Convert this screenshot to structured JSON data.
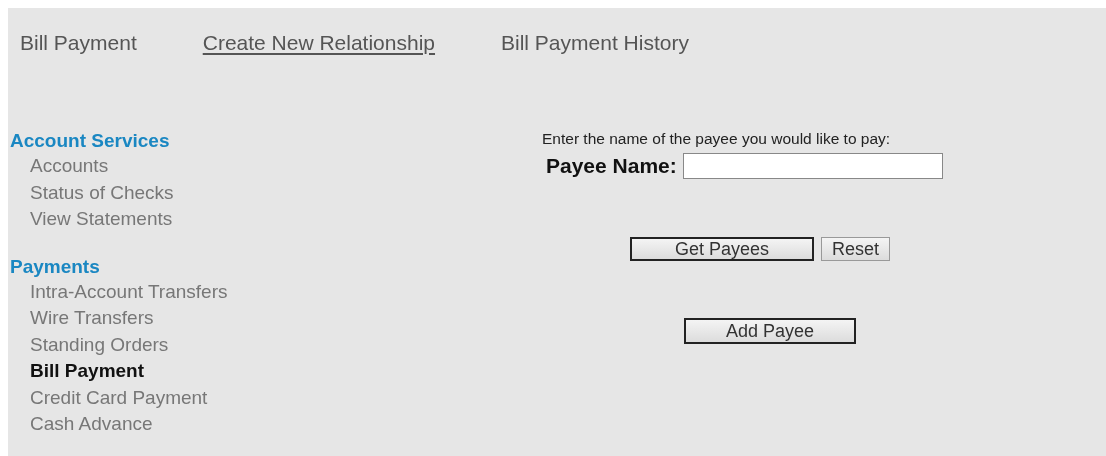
{
  "tabs": [
    {
      "label": "Bill Payment",
      "kind": "plain"
    },
    {
      "label": "Create New Relationship",
      "kind": "link"
    },
    {
      "label": "Bill Payment History",
      "kind": "plain"
    }
  ],
  "sidebar": {
    "sections": [
      {
        "heading": "Account Services",
        "items": [
          {
            "label": "Accounts",
            "selected": false
          },
          {
            "label": "Status of Checks",
            "selected": false
          },
          {
            "label": "View Statements",
            "selected": false
          }
        ]
      },
      {
        "heading": "Payments",
        "items": [
          {
            "label": "Intra-Account Transfers",
            "selected": false
          },
          {
            "label": "Wire Transfers",
            "selected": false
          },
          {
            "label": "Standing Orders",
            "selected": false
          },
          {
            "label": "Bill Payment",
            "selected": true
          },
          {
            "label": "Credit Card Payment",
            "selected": false
          },
          {
            "label": "Cash Advance",
            "selected": false
          }
        ]
      }
    ]
  },
  "form": {
    "instruction": "Enter the name of the payee you would like to pay:",
    "field_label": "Payee Name:",
    "buttons": [
      {
        "label": "Get Payees",
        "default": true
      },
      {
        "label": "Reset",
        "default": false
      }
    ],
    "add_button": {
      "label": "Add Payee",
      "default": true
    }
  }
}
